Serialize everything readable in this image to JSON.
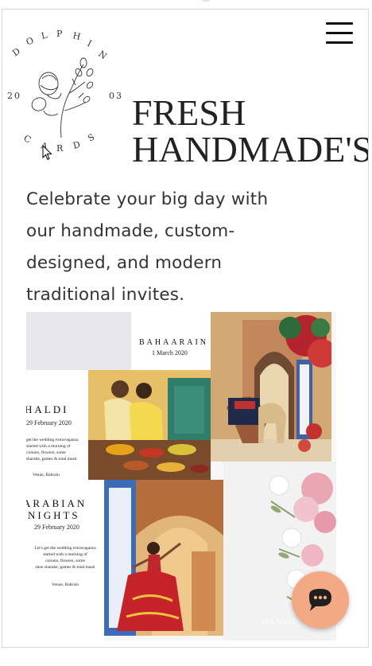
{
  "logo": {
    "arc_top": "DOLPHIN",
    "arc_bottom": "CARDS",
    "year_left": "20",
    "year_right": "03"
  },
  "header": {
    "menu_icon": "hamburger-menu-icon"
  },
  "hero": {
    "title_line1": "FRESH",
    "title_line2": "HANDMADE'S",
    "subtitle_line1": "Celebrate your big day with",
    "subtitle_line2": "our handmade, custom-",
    "subtitle_line3": "designed,  and modern",
    "subtitle_line4": "traditional invites."
  },
  "collage": {
    "bahaarain": {
      "title": "BAHAARAIN",
      "date": "1 March 2020"
    },
    "haldi": {
      "title": "HALDI",
      "date": "29 February 2020",
      "body_line1": "get the wedding extravaganza",
      "body_line2": "started with a morning of",
      "body_line3": "colours, flowers, some",
      "body_line4": "sharabe, games & total masti",
      "venue": "Venue, Bahrain"
    },
    "arabian": {
      "title_line1": "ARABIAN",
      "title_line2": "NIGHTS",
      "date": "29 February 2020",
      "body_line1": "Let's get the wedding extravaganza",
      "body_line2": "started with a morning of",
      "body_line3": "colours, flowers, some",
      "body_line4": "shoe sharabe, games & total masti",
      "venue": "Venue, Bahrain"
    },
    "watermark": "Pink Whistle"
  },
  "chat": {
    "icon": "chat-bubble-icon"
  },
  "colors": {
    "chat_button": "#f3a983",
    "text_dark": "#222222",
    "frame_border": "#d9d9d9"
  }
}
